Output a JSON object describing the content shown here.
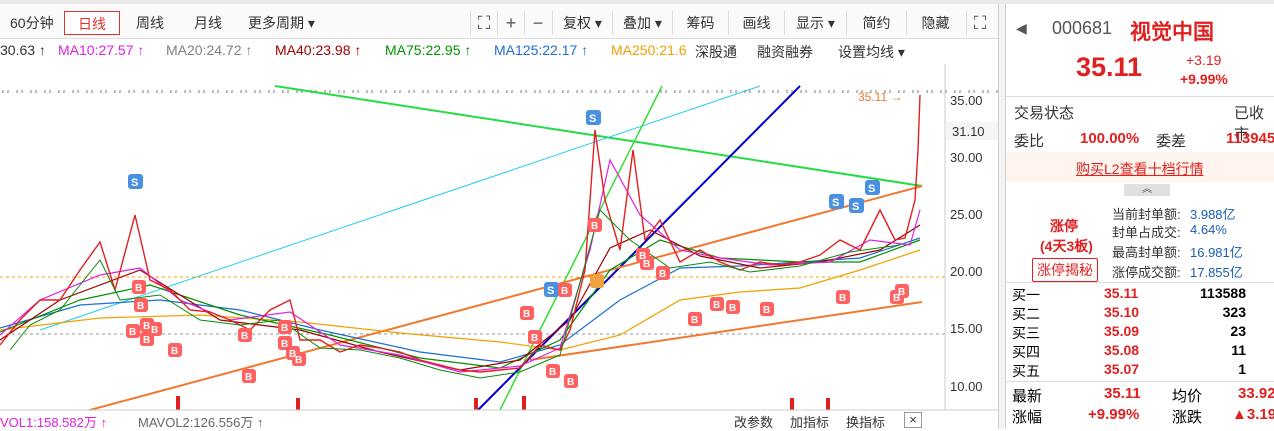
{
  "toolbar": {
    "tabs": [
      {
        "label": "60分钟",
        "active": false
      },
      {
        "label": "日线",
        "active": true
      },
      {
        "label": "周线",
        "active": false
      },
      {
        "label": "月线",
        "active": false
      },
      {
        "label": "更多周期 ▾",
        "active": false
      }
    ],
    "buttons": [
      "复权 ▾",
      "叠加 ▾",
      "筹码",
      "画线",
      "显示 ▾",
      "简约",
      "隐藏"
    ]
  },
  "ma_legend": [
    {
      "text": "30.63 ↑",
      "color": "#333333"
    },
    {
      "text": "MA10:27.57 ↑",
      "color": "#e020e0"
    },
    {
      "text": "MA20:24.72 ↑",
      "color": "#808080"
    },
    {
      "text": "MA40:23.98 ↑",
      "color": "#a00000"
    },
    {
      "text": "MA75:22.95 ↑",
      "color": "#009000"
    },
    {
      "text": "MA125:22.17 ↑",
      "color": "#1a6fd0"
    },
    {
      "text": "MA250:21.6",
      "color": "#f0a000"
    }
  ],
  "chart_buttons": [
    "深股通",
    "融资融券",
    "设置均线 ▾"
  ],
  "chart": {
    "price_ticks": [
      "35.00",
      "30.00",
      "25.00",
      "20.00",
      "15.00",
      "10.00"
    ],
    "last_price_label": "35.11 →",
    "crosshair_value": "31.10"
  },
  "volume_legend": {
    "vol1": "VOL1:158.582万 ↑",
    "mavol2": "MAVOL2:126.556万 ↑"
  },
  "bottom_buttons": [
    "改参数",
    "加指标",
    "换指标"
  ],
  "stock": {
    "code": "000681",
    "name": "视觉中国",
    "price": "35.11",
    "change": "+3.19",
    "change_pct": "+9.99%"
  },
  "status": {
    "label": "交易状态",
    "value": "已收市"
  },
  "weibi": {
    "label1": "委比",
    "value1": "100.00%",
    "label2": "委差",
    "value2": "113945"
  },
  "l2_link": "购买L2查看十档行情",
  "limit_up": {
    "title": "涨停",
    "days": "(4天3板)",
    "reveal_button": "涨停揭秘",
    "stats": [
      {
        "label": "当前封单额:",
        "value": "3.988亿"
      },
      {
        "label": "封单占成交:",
        "value": "4.64%"
      },
      {
        "label": "最高封单额:",
        "value": "16.981亿"
      },
      {
        "label": "涨停成交额:",
        "value": "17.855亿"
      }
    ]
  },
  "orderbook": [
    {
      "label": "买一",
      "price": "35.11",
      "vol": "113588"
    },
    {
      "label": "买二",
      "price": "35.10",
      "vol": "323"
    },
    {
      "label": "买三",
      "price": "35.09",
      "vol": "23"
    },
    {
      "label": "买四",
      "price": "35.08",
      "vol": "11"
    },
    {
      "label": "买五",
      "price": "35.07",
      "vol": "1"
    }
  ],
  "summary": [
    {
      "l1": "最新",
      "v1": "35.11",
      "l2": "均价",
      "v2": "33.92"
    },
    {
      "l1": "涨幅",
      "v1": "+9.99%",
      "l2": "涨跌",
      "v2": "▲3.19"
    }
  ],
  "colors": {
    "up": "#e02020",
    "down": "#0a8a0a",
    "accent": "#e03030",
    "buy_marker": "#ff6060",
    "sell_marker": "#4a90e2"
  }
}
